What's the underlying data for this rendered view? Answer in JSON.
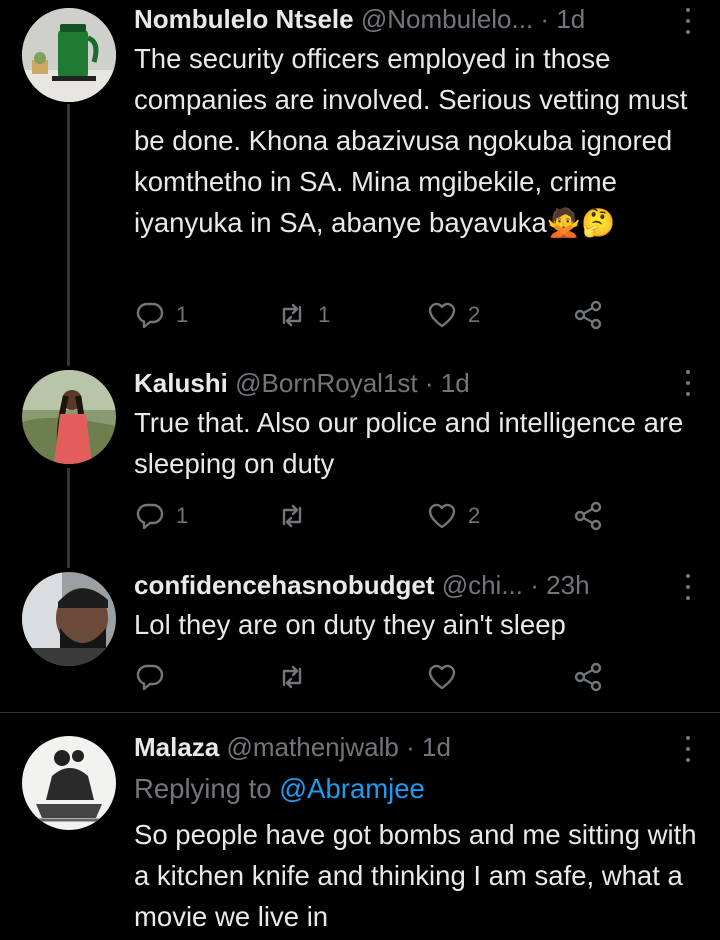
{
  "tweets": [
    {
      "name": "Nombulelo Ntsele",
      "handle": "@Nombulelo...",
      "time": "1d",
      "text": "The security officers employed in those companies are involved. Serious vetting must be done. Khona abazivusa ngokuba ignored komthetho in SA. Mina mgibekile, crime iyanyuka in SA, abanye bayavuka🙅🤔",
      "replies": "1",
      "retweets": "1",
      "likes": "2"
    },
    {
      "name": "Kalushi",
      "handle": "@BornRoyal1st",
      "time": "1d",
      "text": "True that. Also our police and intelligence are sleeping on duty",
      "replies": "1",
      "retweets": "",
      "likes": "2"
    },
    {
      "name": "confidencehasnobudget",
      "handle": "@chi...",
      "time": "23h",
      "text": "Lol they are on duty they ain't sleep",
      "replies": "",
      "retweets": "",
      "likes": ""
    },
    {
      "name": "Malaza",
      "handle": "@mathenjwalb",
      "time": "1d",
      "replying_label": "Replying to",
      "replying_handle": "@Abramjee",
      "text": "So people have got bombs and me sitting with a kitchen knife and thinking I am safe, what a movie we live in"
    }
  ],
  "dot": "·",
  "colors": {
    "background": "#000000",
    "text": "#e7e9ea",
    "muted": "#71767b",
    "link": "#1d9bf0"
  },
  "icons": [
    "reply-icon",
    "retweet-icon",
    "like-icon",
    "share-icon",
    "more-icon"
  ]
}
